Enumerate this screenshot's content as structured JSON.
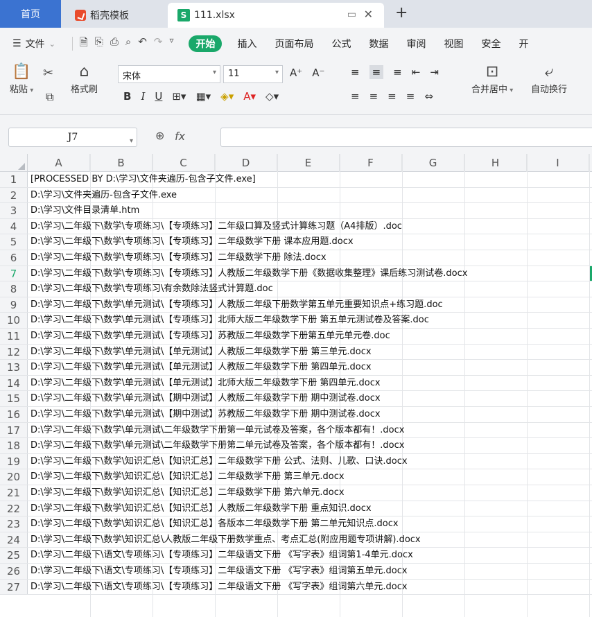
{
  "tabs": {
    "home": "首页",
    "template": "稻壳模板",
    "file": "111.xlsx",
    "file_icon": "S"
  },
  "menu": {
    "file": "文件",
    "items": [
      "开始",
      "插入",
      "页面布局",
      "公式",
      "数据",
      "审阅",
      "视图",
      "安全",
      "开"
    ]
  },
  "ribbon": {
    "paste": "粘贴",
    "format_painter": "格式刷",
    "font_name": "宋体",
    "font_size": "11",
    "merge": "合并居中",
    "wrap": "自动换行"
  },
  "formula_bar": {
    "cell_ref": "J7",
    "fx": "fx",
    "content": ""
  },
  "columns": [
    "A",
    "B",
    "C",
    "D",
    "E",
    "F",
    "G",
    "H",
    "I"
  ],
  "active_row": 7,
  "rows": [
    "[PROCESSED BY D:\\学习\\文件夹遍历-包含子文件.exe]",
    "D:\\学习\\文件夹遍历-包含子文件.exe",
    "D:\\学习\\文件目录清单.htm",
    "D:\\学习\\二年级下\\数学\\专项练习\\【专项练习】二年级口算及竖式计算练习题（A4排版）.doc",
    "D:\\学习\\二年级下\\数学\\专项练习\\【专项练习】二年级数学下册 课本应用题.docx",
    "D:\\学习\\二年级下\\数学\\专项练习\\【专项练习】二年级数学下册 除法.docx",
    "D:\\学习\\二年级下\\数学\\专项练习\\【专项练习】人教版二年级数学下册《数据收集整理》课后练习测试卷.docx",
    "D:\\学习\\二年级下\\数学\\专项练习\\有余数除法竖式计算题.doc",
    "D:\\学习\\二年级下\\数学\\单元测试\\【专项练习】人教版二年级下册数学第五单元重要知识点+练习题.doc",
    "D:\\学习\\二年级下\\数学\\单元测试\\【专项练习】北师大版二年级数学下册 第五单元测试卷及答案.doc",
    "D:\\学习\\二年级下\\数学\\单元测试\\【专项练习】苏教版二年级数学下册第五单元单元卷.doc",
    "D:\\学习\\二年级下\\数学\\单元测试\\【单元测试】人教版二年级数学下册 第三单元.docx",
    "D:\\学习\\二年级下\\数学\\单元测试\\【单元测试】人教版二年级数学下册 第四单元.docx",
    "D:\\学习\\二年级下\\数学\\单元测试\\【单元测试】北师大版二年级数学下册 第四单元.docx",
    "D:\\学习\\二年级下\\数学\\单元测试\\【期中测试】人教版二年级数学下册 期中测试卷.docx",
    "D:\\学习\\二年级下\\数学\\单元测试\\【期中测试】苏教版二年级数学下册 期中测试卷.docx",
    "D:\\学习\\二年级下\\数学\\单元测试\\二年级数学下册第一单元试卷及答案，各个版本都有！.docx",
    "D:\\学习\\二年级下\\数学\\单元测试\\二年级数学下册第二单元试卷及答案，各个版本都有！.docx",
    "D:\\学习\\二年级下\\数学\\知识汇总\\【知识汇总】二年级数学下册 公式、法则、儿歌、口诀.docx",
    "D:\\学习\\二年级下\\数学\\知识汇总\\【知识汇总】二年级数学下册 第三单元.docx",
    "D:\\学习\\二年级下\\数学\\知识汇总\\【知识汇总】二年级数学下册 第六单元.docx",
    "D:\\学习\\二年级下\\数学\\知识汇总\\【知识汇总】人教版二年级数学下册 重点知识.docx",
    "D:\\学习\\二年级下\\数学\\知识汇总\\【知识汇总】各版本二年级数学下册 第二单元知识点.docx",
    "D:\\学习\\二年级下\\数学\\知识汇总\\人教版二年级下册数学重点、考点汇总(附应用题专项讲解).docx",
    "D:\\学习\\二年级下\\语文\\专项练习\\【专项练习】二年级语文下册 《写字表》组词第1-4单元.docx",
    "D:\\学习\\二年级下\\语文\\专项练习\\【专项练习】二年级语文下册 《写字表》组词第五单元.docx",
    "D:\\学习\\二年级下\\语文\\专项练习\\【专项练习】二年级语文下册 《写字表》组词第六单元.docx"
  ]
}
